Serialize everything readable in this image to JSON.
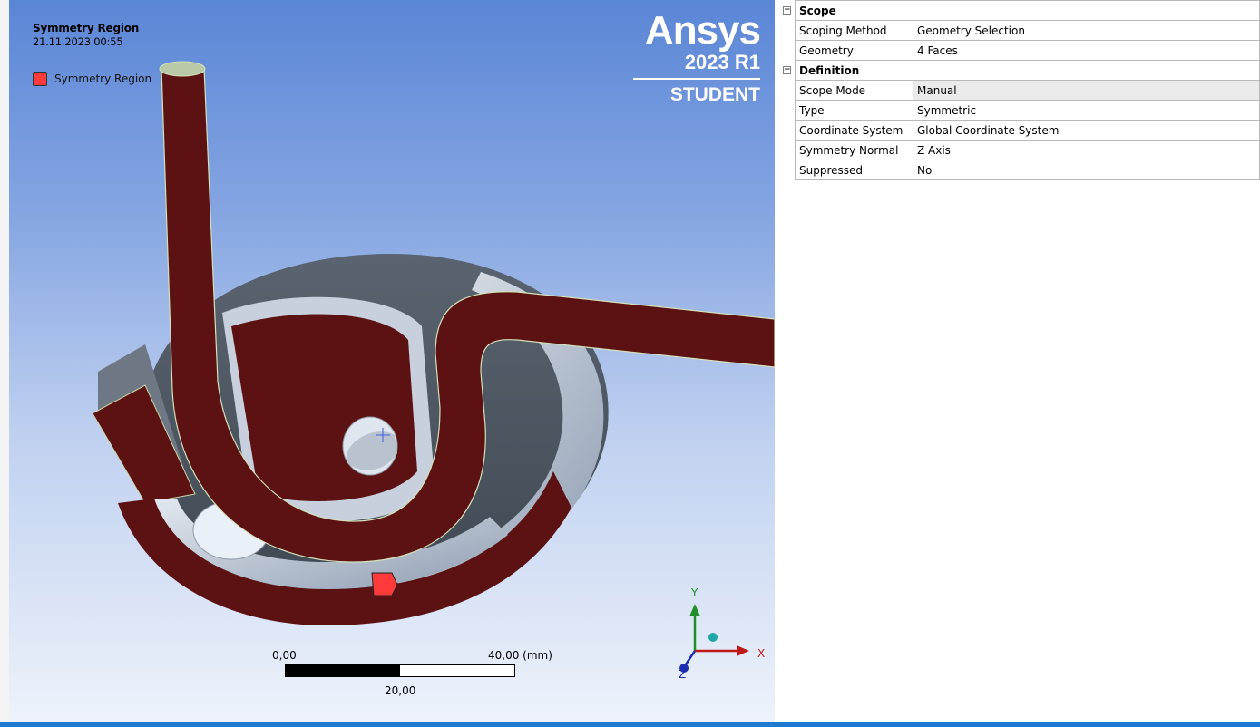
{
  "viewport": {
    "title": "Symmetry Region",
    "timestamp": "21.11.2023 00:55",
    "legend": {
      "label": "Symmetry Region",
      "color": "#ff3a3a"
    },
    "logo": {
      "word": "Ansys",
      "version": "2023 R1",
      "edition": "STUDENT"
    },
    "scale": {
      "left": "0,00",
      "right": "40,00 (mm)",
      "mid": "20,00"
    },
    "triad": {
      "y": "Y",
      "x": "X",
      "z": "Z"
    }
  },
  "details": {
    "sections": [
      {
        "name": "Scope",
        "rows": [
          {
            "key": "Scoping Method",
            "value": "Geometry Selection"
          },
          {
            "key": "Geometry",
            "value": "4 Faces"
          }
        ]
      },
      {
        "name": "Definition",
        "rows": [
          {
            "key": "Scope Mode",
            "value": "Manual"
          },
          {
            "key": "Type",
            "value": "Symmetric"
          },
          {
            "key": "Coordinate System",
            "value": "Global Coordinate System"
          },
          {
            "key": "Symmetry Normal",
            "value": "Z Axis"
          },
          {
            "key": "Suppressed",
            "value": "No"
          }
        ]
      }
    ]
  },
  "colors": {
    "accent": "#1c7ad1",
    "model_face": "#5c1212",
    "model_side": "#b9c4d2"
  }
}
